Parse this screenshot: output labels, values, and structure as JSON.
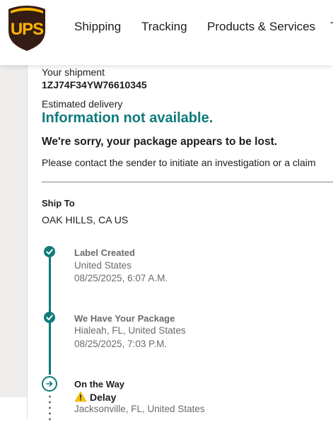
{
  "header": {
    "logo_text": "UPS",
    "nav": [
      "Shipping",
      "Tracking",
      "Products & Services"
    ],
    "nav_overflow": "T"
  },
  "shipment": {
    "label": "Your shipment",
    "tracking_number": "1ZJ74F34YW76610345",
    "delivery_label": "Estimated delivery",
    "delivery_status": "Information not available.",
    "alert": "We're sorry, your package appears to be lost.",
    "message": "Please contact the sender to initiate an investigation or a claim"
  },
  "ship_to": {
    "label": "Ship To",
    "value": "OAK HILLS, CA US"
  },
  "timeline": [
    {
      "title": "Label Created",
      "location": "United States",
      "datetime": "08/25/2025, 6:07 A.M.",
      "status": "done"
    },
    {
      "title": "We Have Your Package",
      "location": "Hialeah, FL, United States",
      "datetime": "08/25/2025, 7:03 P.M.",
      "status": "done"
    },
    {
      "title": "On the Way",
      "alert": "Delay",
      "location": "Jacksonville, FL, United States",
      "status": "current"
    }
  ],
  "colors": {
    "accent": "#0f7b7b",
    "brand_brown": "#351c15",
    "brand_gold": "#ffb500",
    "warning": "#f5c400"
  }
}
